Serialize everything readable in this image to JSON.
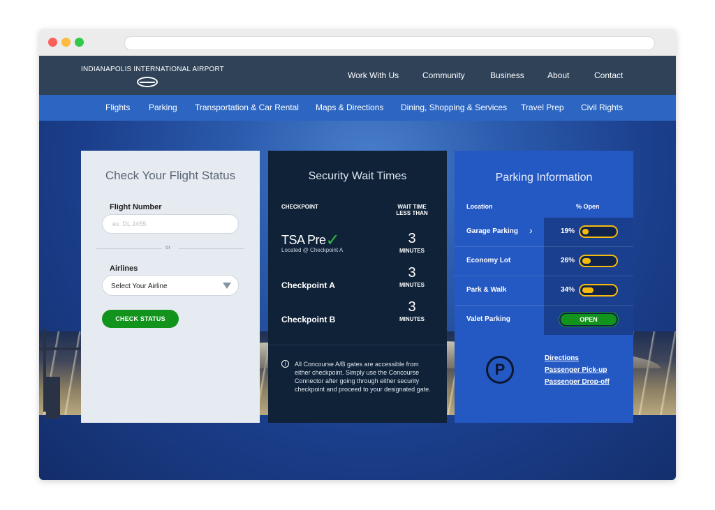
{
  "site": {
    "logo_text": "INDIANAPOLIS INTERNATIONAL AIRPORT",
    "logo_icon": "airplane-icon"
  },
  "top_nav": [
    "Work With Us",
    "Community",
    "Business",
    "About",
    "Contact"
  ],
  "main_nav": [
    "Flights",
    "Parking",
    "Transportation & Car Rental",
    "Maps & Directions",
    "Dining, Shopping & Services",
    "Travel Prep",
    "Civil Rights"
  ],
  "flight_status": {
    "title": "Check Your Flight Status",
    "flight_number_label": "Flight Number",
    "flight_number_placeholder": "ex. DL 2455",
    "or": "or",
    "airlines_label": "Airlines",
    "airline_select_value": "Select Your Airline",
    "button": "CHECK STATUS"
  },
  "security": {
    "title": "Security Wait Times",
    "col_checkpoint": "CHECKPOINT",
    "col_wait_line1": "WAIT TIME",
    "col_wait_line2": "LESS THAN",
    "rows": [
      {
        "name": "TSA Pre",
        "sub": "Located @ Checkpoint A",
        "wait": "3",
        "unit": "MINUTES"
      },
      {
        "name": "Checkpoint A",
        "wait": "3",
        "unit": "MINUTES"
      },
      {
        "name": "Checkpoint B",
        "wait": "3",
        "unit": "MINUTES"
      }
    ],
    "note": "All Concourse A/B gates are accessible from either checkpoint. Simply use the Concourse Connector after going through either security checkpoint and proceed to your designated gate."
  },
  "parking": {
    "title": "Parking Information",
    "col_location": "Location",
    "col_open": "% Open",
    "rows": [
      {
        "name": "Garage Parking",
        "pct": "19%",
        "fill": 0.19
      },
      {
        "name": "Economy Lot",
        "pct": "26%",
        "fill": 0.26
      },
      {
        "name": "Park & Walk",
        "pct": "34%",
        "fill": 0.34
      },
      {
        "name": "Valet Parking",
        "status": "OPEN"
      }
    ],
    "links": [
      "Directions",
      "Passenger Pick-up",
      "Passenger Drop-off"
    ],
    "icon_letter": "P"
  },
  "colors": {
    "topbar": "#2f4258",
    "main_nav": "#2c66c2",
    "security_panel": "#0f2238",
    "parking_panel": "#2458c2",
    "check_button": "#11931c",
    "gauge": "#f6bb0b"
  }
}
